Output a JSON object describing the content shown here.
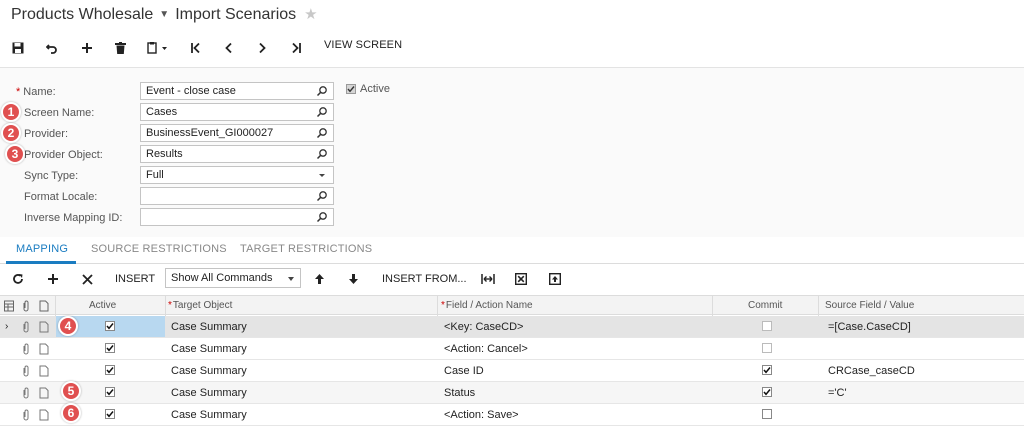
{
  "header": {
    "company": "Products Wholesale",
    "screen_title": "Import Scenarios"
  },
  "toolbar": {
    "view_screen_label": "VIEW SCREEN"
  },
  "form": {
    "name": {
      "label": "Name:",
      "value": "Event - close case"
    },
    "active": {
      "label": "Active",
      "checked": true
    },
    "screen_name": {
      "label": "Screen Name:",
      "value": "Cases"
    },
    "provider": {
      "label": "Provider:",
      "value": "BusinessEvent_GI000027"
    },
    "provider_object": {
      "label": "Provider Object:",
      "value": "Results"
    },
    "sync_type": {
      "label": "Sync Type:",
      "value": "Full"
    },
    "format_locale": {
      "label": "Format Locale:",
      "value": ""
    },
    "inverse_mapping_id": {
      "label": "Inverse Mapping ID:",
      "value": ""
    }
  },
  "callouts": [
    "1",
    "2",
    "3",
    "4",
    "5",
    "6"
  ],
  "tabs": [
    {
      "label": "MAPPING",
      "active": true
    },
    {
      "label": "SOURCE RESTRICTIONS",
      "active": false
    },
    {
      "label": "TARGET RESTRICTIONS",
      "active": false
    }
  ],
  "grid_toolbar": {
    "insert_label": "INSERT",
    "commands_select": "Show All Commands",
    "insert_from_label": "INSERT FROM..."
  },
  "grid": {
    "columns": {
      "active": "Active",
      "target_object": "Target Object",
      "field_action": "Field / Action Name",
      "commit": "Commit",
      "source": "Source Field / Value"
    },
    "rows": [
      {
        "active": true,
        "target_object": "Case Summary",
        "field_action": "<Key: CaseCD>",
        "commit": false,
        "source": "=[Case.CaseCD]"
      },
      {
        "active": true,
        "target_object": "Case Summary",
        "field_action": "<Action: Cancel>",
        "commit": false,
        "source": ""
      },
      {
        "active": true,
        "target_object": "Case Summary",
        "field_action": "Case ID",
        "commit": true,
        "source": "CRCase_caseCD"
      },
      {
        "active": true,
        "target_object": "Case Summary",
        "field_action": "Status",
        "commit": true,
        "source": "='C'"
      },
      {
        "active": true,
        "target_object": "Case Summary",
        "field_action": "<Action: Save>",
        "commit": false,
        "source": ""
      }
    ]
  },
  "colors": {
    "accent": "#1a7cc1",
    "callout": "#e05050",
    "selected_cell": "#b8d8f0"
  }
}
